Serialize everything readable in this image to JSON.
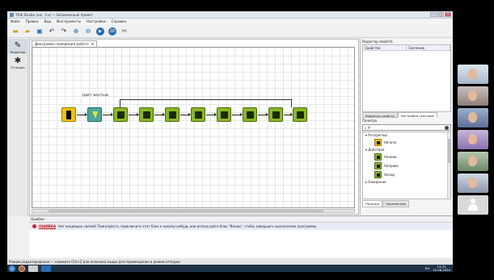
{
  "window": {
    "title": "TRIK Studio (ver. 3.x) — Безымянный проект"
  },
  "menu": [
    "Файл",
    "Правка",
    "Вид",
    "Инструменты",
    "Настройки",
    "Справка"
  ],
  "left_bar": {
    "items": [
      {
        "label": "Редактор",
        "icon": "pencil-icon"
      },
      {
        "label": "Отладка",
        "icon": "bug-icon"
      }
    ]
  },
  "editor": {
    "tab_label": "Диаграмма поведения робота",
    "condition_label": "Цвет желтый"
  },
  "right_panel": {
    "properties_title": "Редактор свойств",
    "col_property": "Свойство",
    "col_value": "Значение",
    "tab_properties": "Редактор свойств",
    "tab_robot": "Настройки сенсоров",
    "palette_title": "Палитра",
    "search_value": "Р",
    "categories": [
      {
        "name": "Алгоритмы",
        "items": [
          {
            "label": "Начало",
            "icon": "start-block-icon",
            "color": "yellow"
          }
        ]
      },
      {
        "name": "Действия",
        "items": [
          {
            "label": "Налево",
            "icon": "left-block-icon",
            "color": "green"
          },
          {
            "label": "Направо",
            "icon": "right-block-icon",
            "color": "green"
          },
          {
            "label": "Назад",
            "icon": "back-block-icon",
            "color": "green"
          }
        ]
      },
      {
        "name": "Ожидания",
        "items": []
      }
    ],
    "bottom_tab_palette": "Палитра",
    "bottom_tab_vars": "Переменные"
  },
  "errors": {
    "title": "Ошибки",
    "type": "ОШИБКА",
    "message": "Нет входящих связей! Пожалуйста, подключите этот блок к какому-нибудь или используйте блок \"Конец\", чтобы завершить выполнение программы"
  },
  "status": {
    "text": "Режим редактирования — нажмите Ctrl+Z или колесико мыши для перемещения в режим отладки"
  },
  "taskbar": {
    "time": "13:31",
    "date": "10.08.2020",
    "lang": "RU"
  },
  "colors": {
    "block_green": "#8ab821",
    "block_yellow": "#f2c10a",
    "block_teal": "#4ca79e",
    "close_red": "#d75454"
  }
}
